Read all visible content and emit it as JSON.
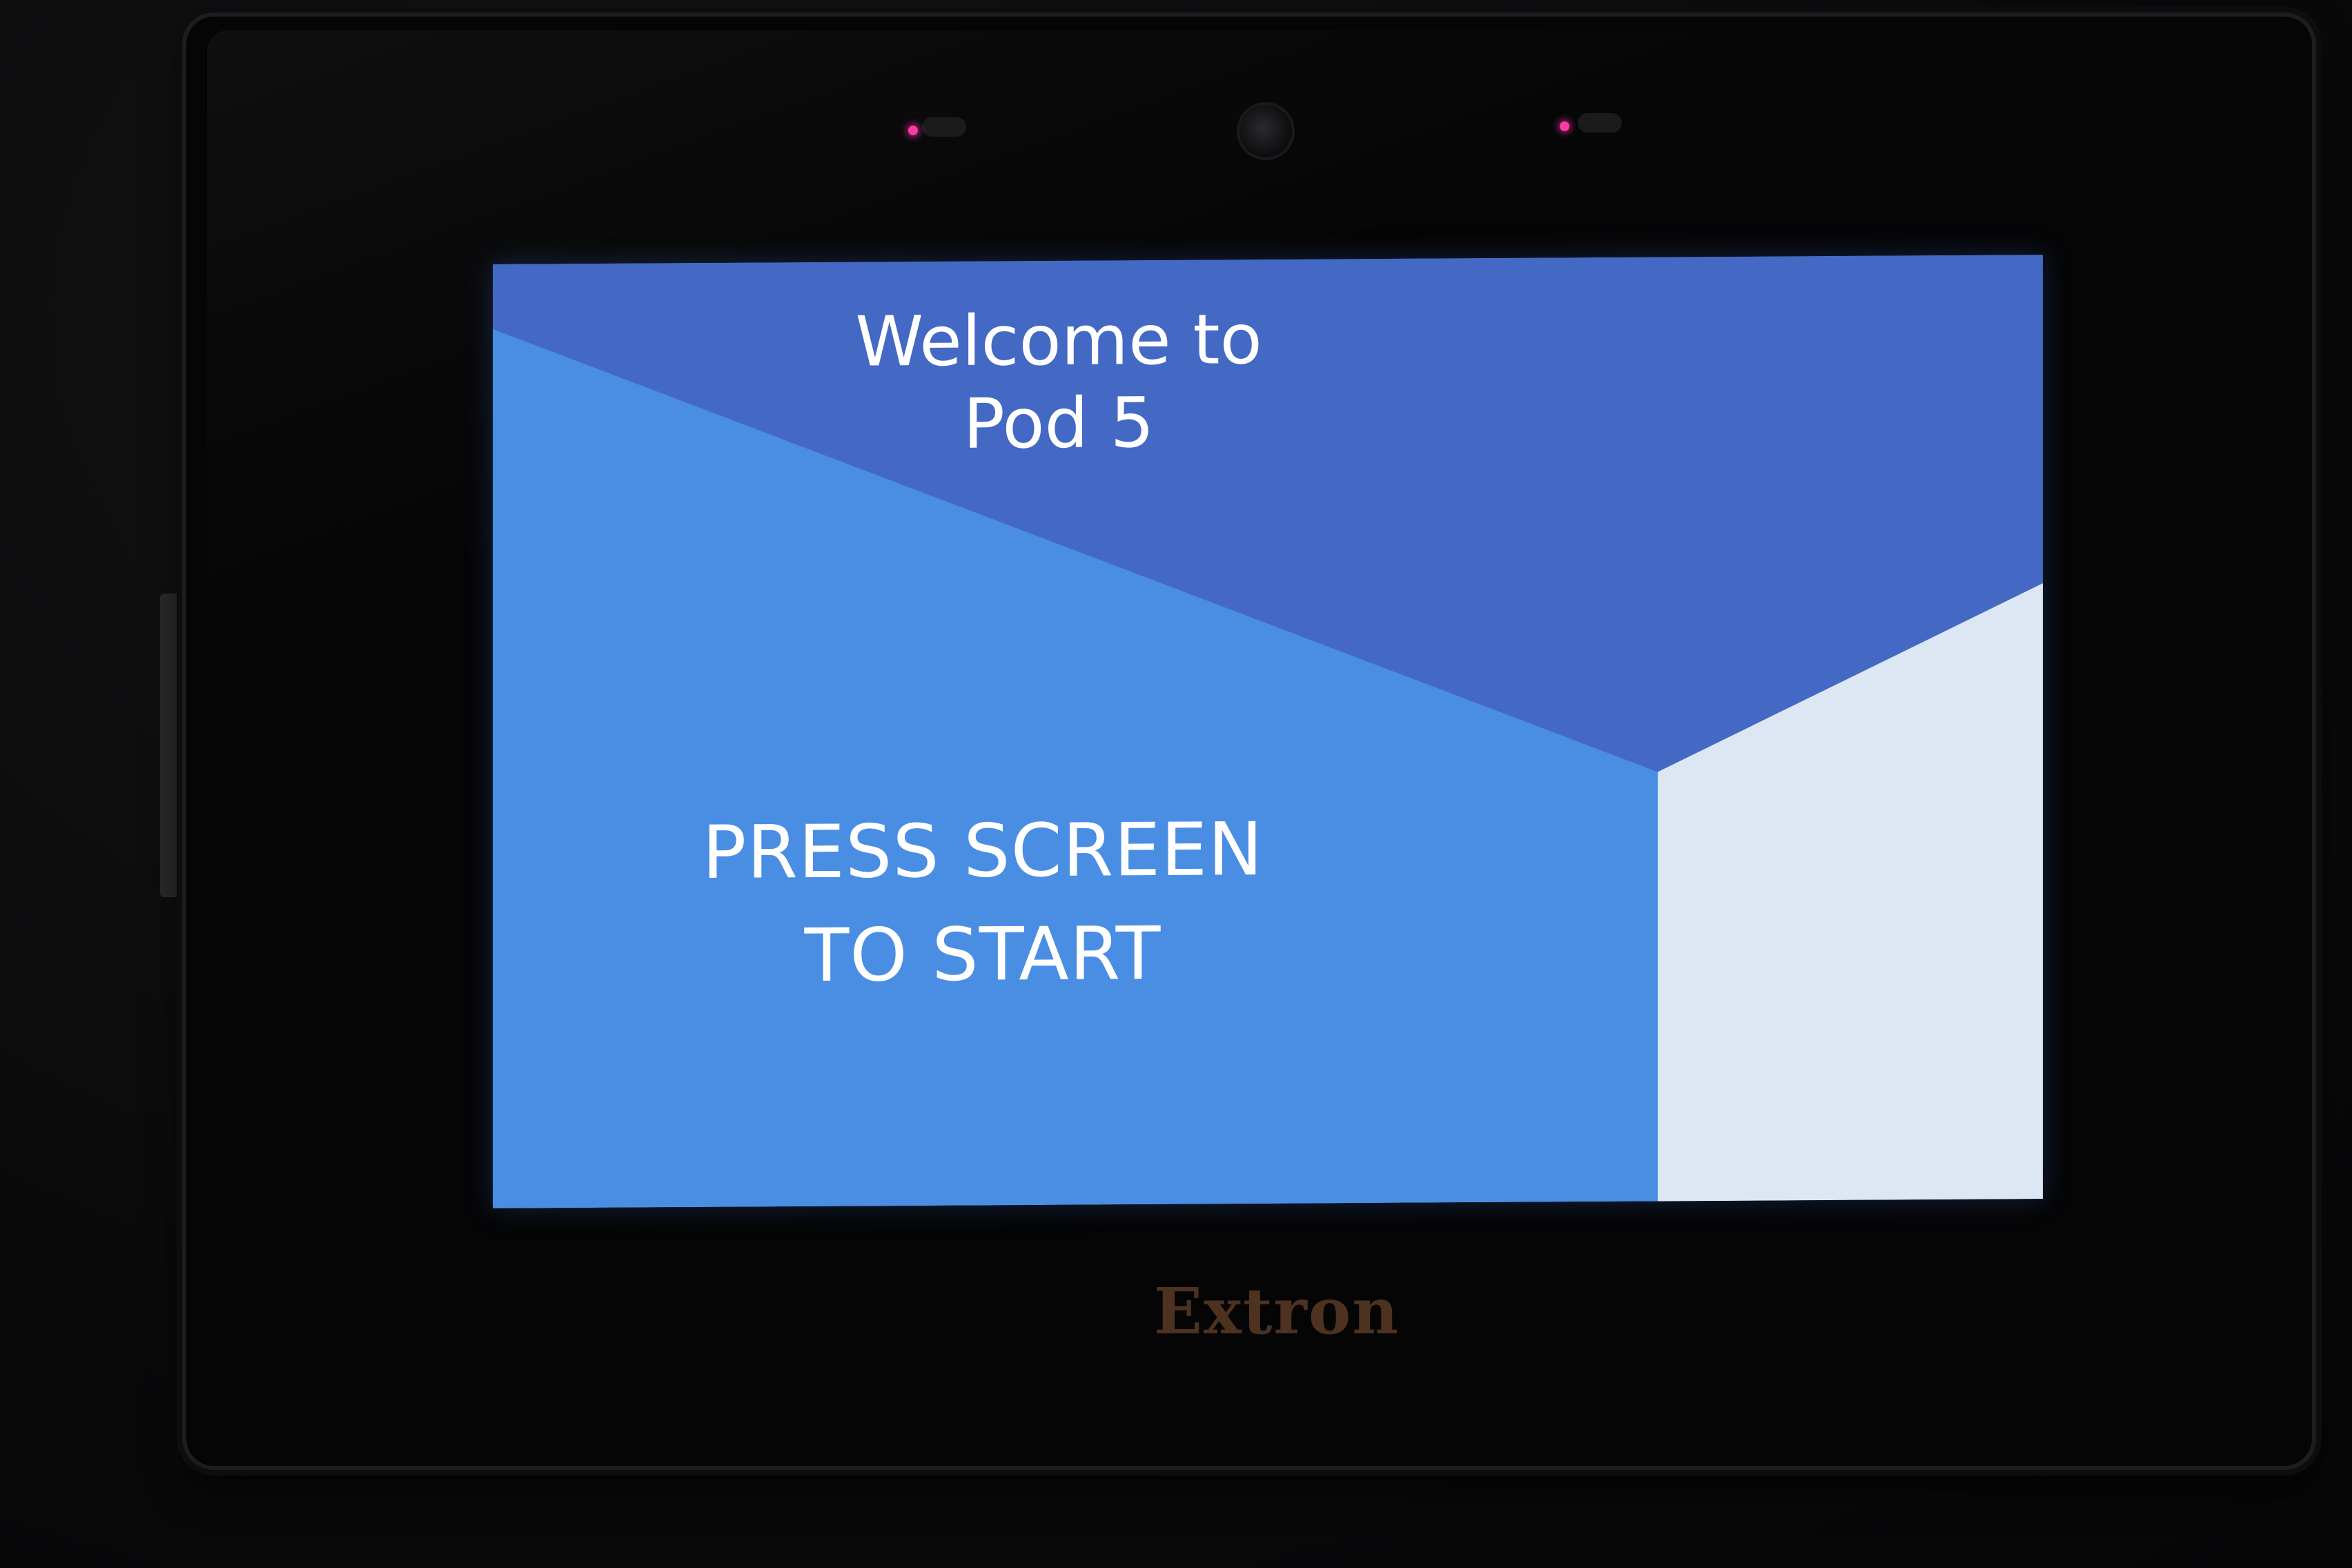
{
  "device": {
    "brand": "Extron",
    "led_color": "#ff3aa6"
  },
  "screen": {
    "title_line1": "Welcome to",
    "title_line2": "Pod 5",
    "prompt_line1": "PRESS SCREEN",
    "prompt_line2": "TO START",
    "colors": {
      "dark_blue": "#4469c4",
      "mid_blue": "#4a8ee4",
      "light_panel": "#dde6f3",
      "text": "#ffffff"
    }
  }
}
